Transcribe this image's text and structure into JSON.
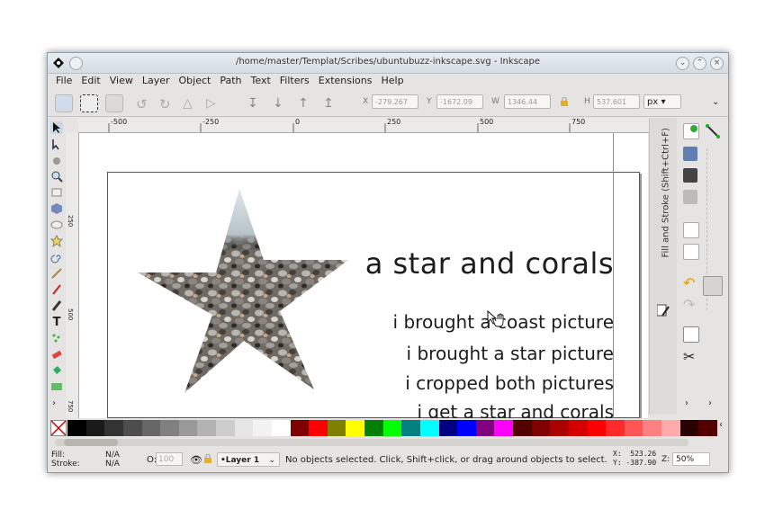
{
  "window": {
    "title": "/home/master/Templat/Scribes/ubuntubuzz-inkscape.svg - Inkscape",
    "app_icon": "inkscape-icon",
    "controls": [
      "minimize-icon",
      "maximize-icon",
      "close-icon"
    ]
  },
  "menu": [
    "File",
    "Edit",
    "View",
    "Layer",
    "Object",
    "Path",
    "Text",
    "Filters",
    "Extensions",
    "Help"
  ],
  "toolbar": {
    "x_label": "X",
    "x_value": "-279.267",
    "y_label": "Y",
    "y_value": "-1672.09",
    "w_label": "W",
    "w_value": "1346.44",
    "h_label": "H",
    "h_value": "537.601",
    "unit": "px"
  },
  "ruler": {
    "labels": [
      "-500",
      "-250",
      "0",
      "250",
      "500",
      "750"
    ],
    "vertical_labels": [
      "250",
      "500",
      "750"
    ]
  },
  "document": {
    "heading": "a star and corals",
    "lines": [
      "i brought a coast picture",
      "i brought a star picture",
      "i cropped both pictures",
      "i get a star and corals"
    ]
  },
  "dock": {
    "panel_title": "Fill and Stroke (Shift+Ctrl+F)"
  },
  "palette": [
    "#000000",
    "#1a1a1a",
    "#333333",
    "#4d4d4d",
    "#666666",
    "#808080",
    "#999999",
    "#b3b3b3",
    "#cccccc",
    "#e6e6e6",
    "#f2f2f2",
    "#ffffff",
    "#800000",
    "#ff0000",
    "#808000",
    "#ffff00",
    "#008000",
    "#00ff00",
    "#008080",
    "#00ffff",
    "#000080",
    "#0000ff",
    "#800080",
    "#ff00ff",
    "#550000",
    "#800000",
    "#aa0000",
    "#d40000",
    "#ff0000",
    "#ff2a2a",
    "#ff5555",
    "#ff8080",
    "#ffaaaa",
    "#2b0000",
    "#550000"
  ],
  "status": {
    "fill_label": "Fill:",
    "fill_value": "N/A",
    "stroke_label": "Stroke:",
    "stroke_value": "N/A",
    "opacity_label": "O:",
    "opacity_value": "100",
    "layer": "•Layer 1",
    "message": "No objects selected. Click, Shift+click, or drag around objects to select.",
    "x_coord": "X:  523.26",
    "y_coord": "Y: -387.90",
    "zoom_label": "Z:",
    "zoom_value": "50%"
  }
}
